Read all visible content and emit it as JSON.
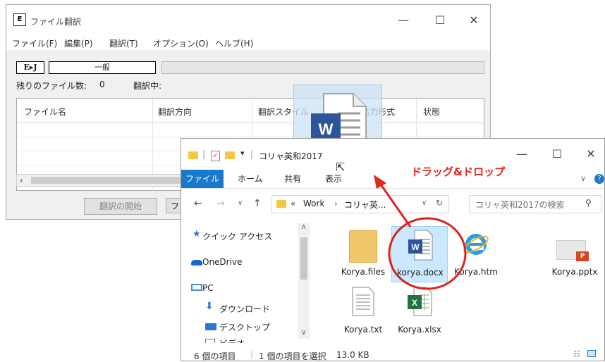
{
  "translation_window": {
    "title": "ファイル翻訳",
    "menu": [
      "ファイル(F)",
      "編集(P)",
      "翻訳(T)",
      "オプション(O)",
      "ヘルプ(H)"
    ],
    "direction_button": "E▸J",
    "style_field": "一般",
    "remaining_label": "残りのファイル数:",
    "remaining_count": "0",
    "translating_label": "翻訳中:",
    "columns": [
      "ファイル名",
      "翻訳方向",
      "翻訳スタイル",
      "出力形式",
      "状態"
    ],
    "start_button": "翻訳の開始",
    "second_button": "フ"
  },
  "explorer": {
    "title": "コリャ英和2017",
    "ribbon_tabs": [
      "ファイル",
      "ホーム",
      "共有",
      "表示"
    ],
    "address": {
      "prefix": "«",
      "crumbs": [
        "Work",
        "コリャ英..."
      ]
    },
    "search_placeholder": "コリャ英和2017の検索",
    "nav": [
      "クイック アクセス",
      "OneDrive",
      "PC",
      "ダウンロード",
      "デスクトップ",
      "ビデオ"
    ],
    "files": [
      "Korya.files",
      "korya.docx",
      "Korya.htm",
      "Korya.pptx",
      "Korya.txt",
      "Korya.xlsx"
    ],
    "status": {
      "items": "6 個の項目",
      "selected": "1 個の項目を選択",
      "size": "13.0 KB"
    }
  },
  "annotation": "ドラッグ&ドロップ",
  "colors": {
    "annotation": "#e0261f",
    "ribbon_file_tab": "#1979ca",
    "word": "#2b579a",
    "excel": "#217346",
    "powerpoint": "#d24726"
  }
}
